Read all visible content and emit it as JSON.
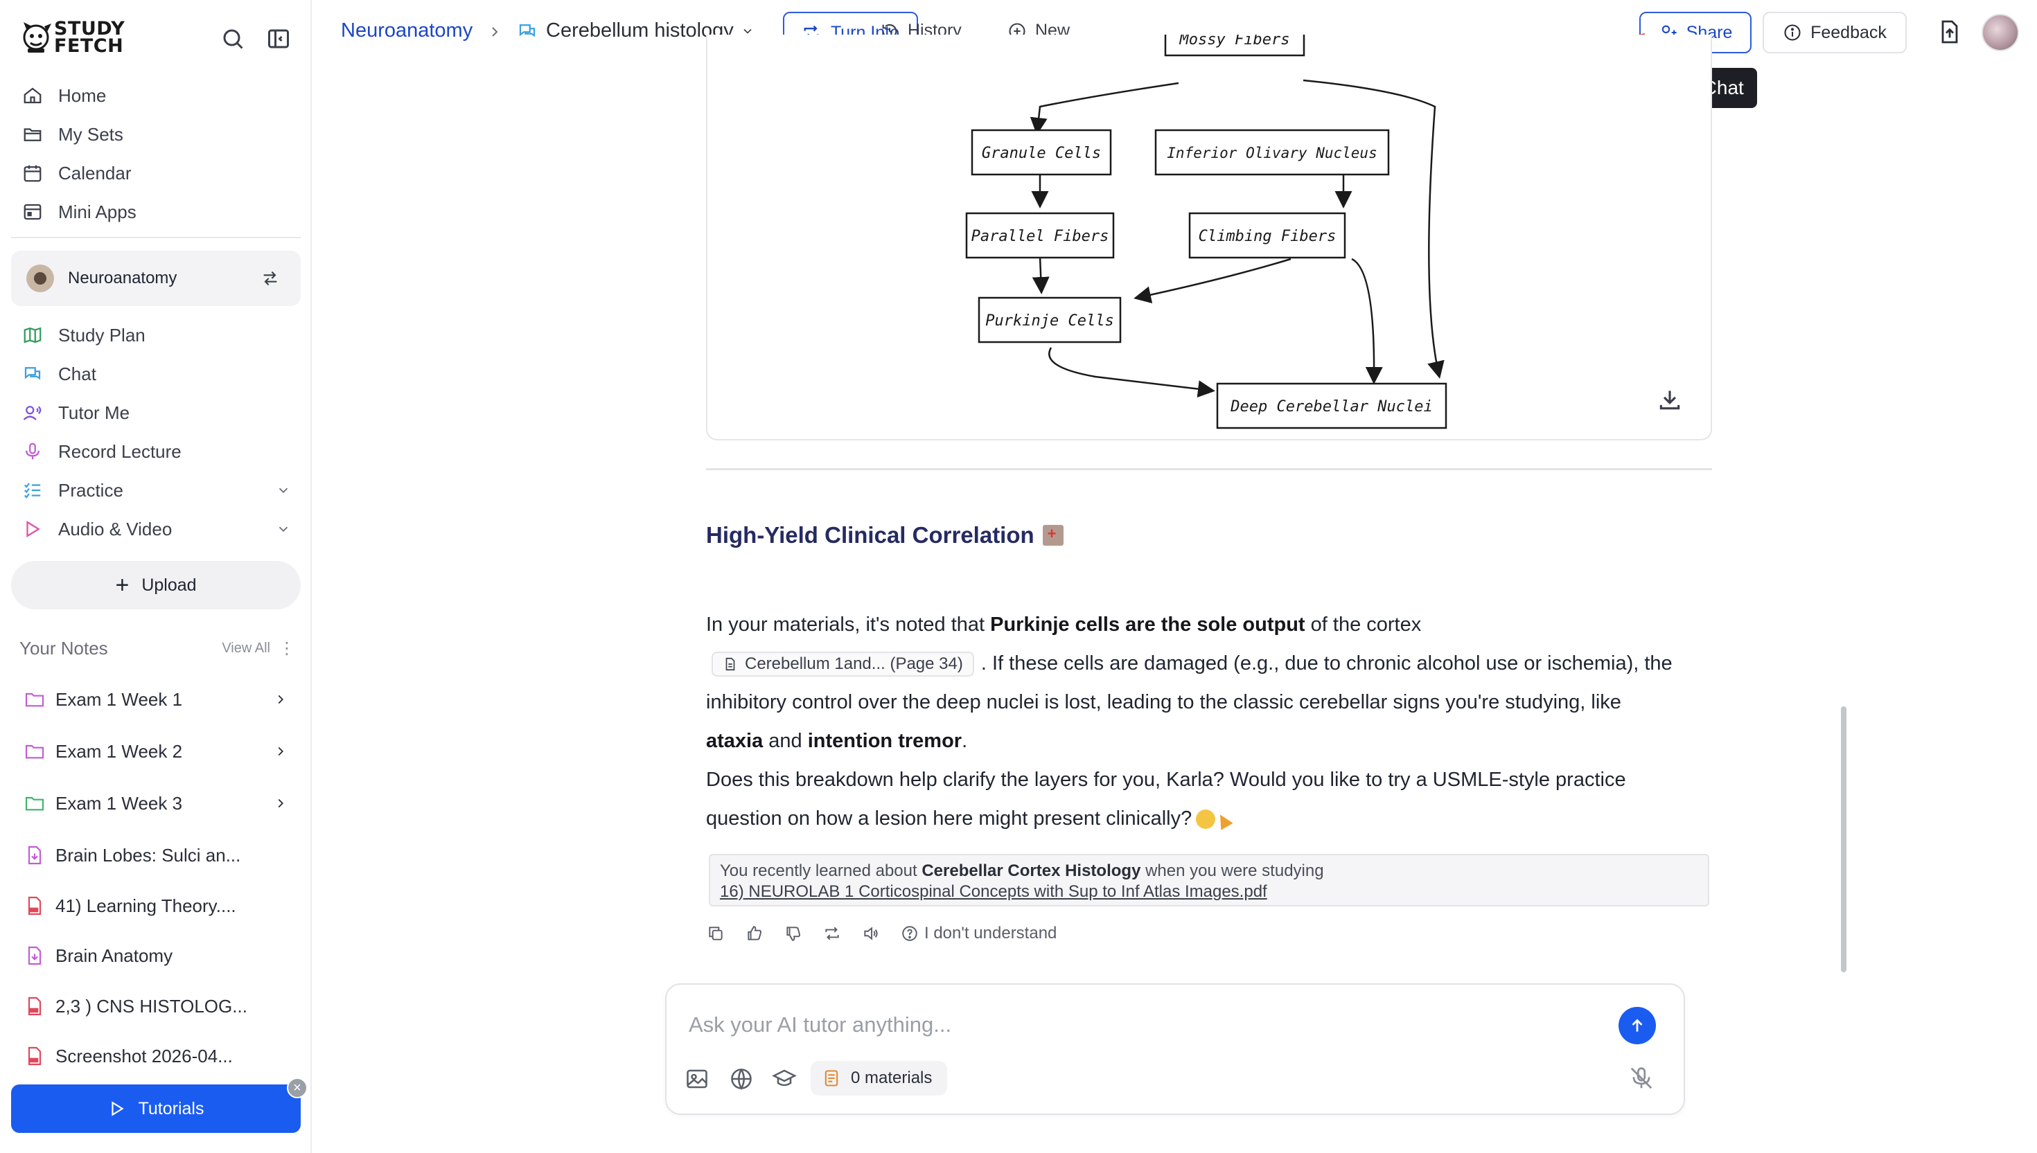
{
  "brand": {
    "line1": "STUDY",
    "line2": "FETCH"
  },
  "sidebar": {
    "top_nav": [
      {
        "label": "Home",
        "icon": "home-icon"
      },
      {
        "label": "My Sets",
        "icon": "folder-icon"
      },
      {
        "label": "Calendar",
        "icon": "calendar-icon"
      },
      {
        "label": "Mini Apps",
        "icon": "app-window-icon"
      }
    ],
    "workspace": {
      "name": "Neuroanatomy"
    },
    "tools": [
      {
        "label": "Study Plan",
        "icon": "map-icon",
        "color": "#2f9e5b"
      },
      {
        "label": "Chat",
        "icon": "chat-icon",
        "color": "#3aa0e0"
      },
      {
        "label": "Tutor Me",
        "icon": "tutor-icon",
        "color": "#7b55d6"
      },
      {
        "label": "Record Lecture",
        "icon": "microphone-icon",
        "color": "#c45ad6"
      },
      {
        "label": "Practice",
        "icon": "checklist-icon",
        "color": "#3aa0e0"
      },
      {
        "label": "Audio & Video",
        "icon": "play-icon",
        "color": "#e04fa8"
      }
    ],
    "upload_label": "Upload",
    "notes": {
      "title": "Your Notes",
      "view_all": "View All",
      "items": [
        {
          "label": "Exam 1 Week 1",
          "type": "folder",
          "color": "#c45ad6"
        },
        {
          "label": "Exam 1 Week 2",
          "type": "folder",
          "color": "#c45ad6"
        },
        {
          "label": "Exam 1 Week 3",
          "type": "folder",
          "color": "#3bb56a"
        },
        {
          "label": "Brain Lobes: Sulci an...",
          "type": "note",
          "color": "#c45ad6"
        },
        {
          "label": "41) Learning Theory....",
          "type": "pdf",
          "color": "#e0475a"
        },
        {
          "label": "Brain Anatomy",
          "type": "note",
          "color": "#c45ad6"
        },
        {
          "label": "2,3 ) CNS HISTOLOG...",
          "type": "pdf",
          "color": "#e0475a"
        },
        {
          "label": "Screenshot 2026-04...",
          "type": "pdf",
          "color": "#e0475a"
        }
      ]
    },
    "tutorials_label": "Tutorials",
    "tutorials_close": "×"
  },
  "topbar": {
    "breadcrumb_root": "Neuroanatomy",
    "breadcrumb_chat": "Cerebellum histology",
    "turn_into": "Turn Into",
    "history": "History",
    "new": "New",
    "share": "Share",
    "feedback": "Feedback",
    "tooltip": "Share Chat"
  },
  "diagram": {
    "nodes": {
      "mossy": "Mossy Fibers",
      "granule": "Granule Cells",
      "olivary": "Inferior Olivary Nucleus",
      "parallel": "Parallel Fibers",
      "climbing": "Climbing Fibers",
      "purkinje": "Purkinje Cells",
      "deep": "Deep Cerebellar Nuclei"
    }
  },
  "message": {
    "section_title": "High-Yield Clinical Correlation",
    "p1_a": "In your materials, it's noted that ",
    "p1_bold": "Purkinje cells are the sole output",
    "p1_b": " of the cortex",
    "citation": "Cerebellum 1and... (Page 34)",
    "p2": ". If these cells are damaged (e.g., due to chronic alcohol use or ischemia), the",
    "p3": "inhibitory control over the deep nuclei is lost, leading to the classic cerebellar signs you're studying, like",
    "p4_bold1": "ataxia",
    "p4_mid": " and ",
    "p4_bold2": "intention tremor",
    "p4_end": ".",
    "p5": "Does this breakdown help clarify the layers for you, Karla? Would you like to try a USMLE-style practice",
    "p6": "question on how a lesion here might present clinically?",
    "recall_prefix": "You recently learned about ",
    "recall_topic": "Cerebellar Cortex Histology",
    "recall_suffix": " when you were studying",
    "recall_file": "16) NEUROLAB 1 Corticospinal Concepts with Sup to Inf Atlas Images.pdf",
    "idk_label": "I don't understand"
  },
  "composer": {
    "placeholder": "Ask your AI tutor anything...",
    "materials": "0 materials"
  },
  "colors": {
    "accent": "#1b5cf0",
    "link": "#1b47c6",
    "annotation_arrow": "#e5452f",
    "title": "#262a63"
  }
}
